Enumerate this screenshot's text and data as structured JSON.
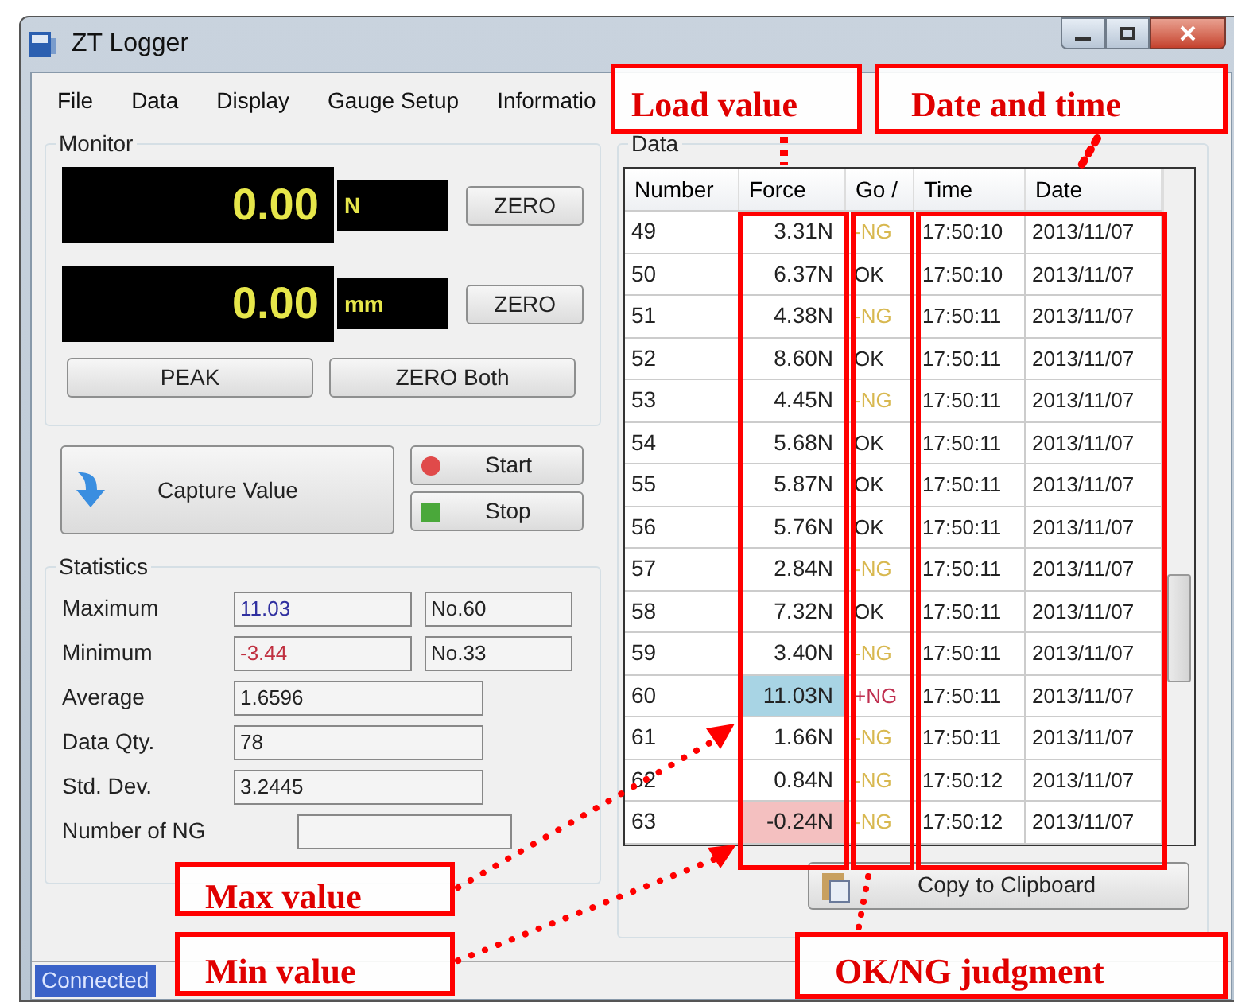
{
  "window": {
    "title": "ZT Logger"
  },
  "menu": [
    "File",
    "Data",
    "Display",
    "Gauge Setup",
    "Informatio"
  ],
  "monitor": {
    "title": "Monitor",
    "displays": [
      {
        "value": "0.00",
        "unit": "N",
        "button": "ZERO"
      },
      {
        "value": "0.00",
        "unit": "mm",
        "button": "ZERO"
      }
    ],
    "buttons": [
      "PEAK",
      "ZERO Both"
    ]
  },
  "capture": {
    "label": "Capture Value"
  },
  "start": {
    "label": "Start"
  },
  "stop": {
    "label": "Stop"
  },
  "statistics": {
    "title": "Statistics",
    "rows": [
      {
        "label": "Maximum",
        "value": "11.03",
        "number": "No.60",
        "kind": "max"
      },
      {
        "label": "Minimum",
        "value": "-3.44",
        "number": "No.33",
        "kind": "min"
      },
      {
        "label": "Average",
        "value": "1.6596",
        "kind": "plain"
      },
      {
        "label": "Data Qty.",
        "value": "78",
        "kind": "plain"
      },
      {
        "label": "Std. Dev.",
        "value": "3.2445",
        "kind": "plain"
      },
      {
        "label": "Number of NG",
        "kind": "short"
      }
    ]
  },
  "data": {
    "title": "Data",
    "columns": [
      "Number",
      "Force",
      "Go /",
      "Time",
      "Date"
    ],
    "rows": [
      {
        "number": "49",
        "force": {
          "text": "3.31N",
          "color": "#ffffff"
        },
        "judgment": {
          "text": "-NG",
          "color": "#d8b850"
        },
        "time": "17:50:10",
        "date": "2013/11/07"
      },
      {
        "number": "50",
        "force": {
          "text": "6.37N",
          "color": "#ffffff"
        },
        "judgment": {
          "text": "OK",
          "color": "#222222"
        },
        "time": "17:50:10",
        "date": "2013/11/07"
      },
      {
        "number": "51",
        "force": {
          "text": "4.38N",
          "color": "#ffffff"
        },
        "judgment": {
          "text": "-NG",
          "color": "#d8b850"
        },
        "time": "17:50:11",
        "date": "2013/11/07"
      },
      {
        "number": "52",
        "force": {
          "text": "8.60N",
          "color": "#ffffff"
        },
        "judgment": {
          "text": "OK",
          "color": "#222222"
        },
        "time": "17:50:11",
        "date": "2013/11/07"
      },
      {
        "number": "53",
        "force": {
          "text": "4.45N",
          "color": "#ffffff"
        },
        "judgment": {
          "text": "-NG",
          "color": "#d8b850"
        },
        "time": "17:50:11",
        "date": "2013/11/07"
      },
      {
        "number": "54",
        "force": {
          "text": "5.68N",
          "color": "#ffffff"
        },
        "judgment": {
          "text": "OK",
          "color": "#222222"
        },
        "time": "17:50:11",
        "date": "2013/11/07"
      },
      {
        "number": "55",
        "force": {
          "text": "5.87N",
          "color": "#ffffff"
        },
        "judgment": {
          "text": "OK",
          "color": "#222222"
        },
        "time": "17:50:11",
        "date": "2013/11/07"
      },
      {
        "number": "56",
        "force": {
          "text": "5.76N",
          "color": "#ffffff"
        },
        "judgment": {
          "text": "OK",
          "color": "#222222"
        },
        "time": "17:50:11",
        "date": "2013/11/07"
      },
      {
        "number": "57",
        "force": {
          "text": "2.84N",
          "color": "#ffffff"
        },
        "judgment": {
          "text": "-NG",
          "color": "#d8b850"
        },
        "time": "17:50:11",
        "date": "2013/11/07"
      },
      {
        "number": "58",
        "force": {
          "text": "7.32N",
          "color": "#ffffff"
        },
        "judgment": {
          "text": "OK",
          "color": "#222222"
        },
        "time": "17:50:11",
        "date": "2013/11/07"
      },
      {
        "number": "59",
        "force": {
          "text": "3.40N",
          "color": "#ffffff"
        },
        "judgment": {
          "text": "-NG",
          "color": "#d8b850"
        },
        "time": "17:50:11",
        "date": "2013/11/07"
      },
      {
        "number": "60",
        "force": {
          "text": "11.03N",
          "color": "#a8d4e4"
        },
        "judgment": {
          "text": "+NG",
          "color": "#c03050"
        },
        "time": "17:50:11",
        "date": "2013/11/07"
      },
      {
        "number": "61",
        "force": {
          "text": "1.66N",
          "color": "#ffffff"
        },
        "judgment": {
          "text": "-NG",
          "color": "#d8b850"
        },
        "time": "17:50:11",
        "date": "2013/11/07"
      },
      {
        "number": "62",
        "force": {
          "text": "0.84N",
          "color": "#ffffff"
        },
        "judgment": {
          "text": "-NG",
          "color": "#d8b850"
        },
        "time": "17:50:12",
        "date": "2013/11/07"
      },
      {
        "number": "63",
        "force": {
          "text": "-0.24N",
          "color": "#f4c0c0"
        },
        "judgment": {
          "text": "-NG",
          "color": "#d8b850"
        },
        "time": "17:50:12",
        "date": "2013/11/07"
      }
    ],
    "copy_button": "Copy to Clipboard"
  },
  "status_bar": {
    "text": "Connected"
  },
  "annotations": [
    {
      "text": "Load value"
    },
    {
      "text": "Date and time"
    },
    {
      "text": "Max value"
    },
    {
      "text": "Min value"
    },
    {
      "text": "OK/NG judgment"
    }
  ]
}
